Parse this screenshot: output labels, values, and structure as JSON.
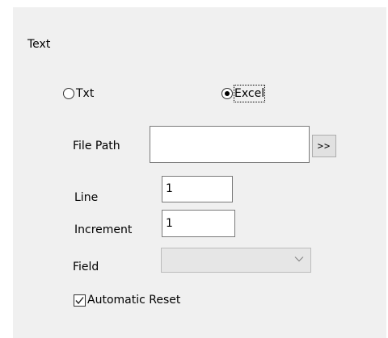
{
  "section": {
    "title": "Text"
  },
  "source_type": {
    "options": [
      {
        "label": "Txt",
        "selected": false
      },
      {
        "label": "Excel",
        "selected": true
      }
    ]
  },
  "file_path": {
    "label": "File Path",
    "value": "",
    "browse_label": ">>"
  },
  "line": {
    "label": "Line",
    "value": "1"
  },
  "increment": {
    "label": "Increment",
    "value": "1"
  },
  "field": {
    "label": "Field",
    "value": "",
    "enabled": false
  },
  "automatic_reset": {
    "label": "Automatic Reset",
    "checked": true
  },
  "icons": {
    "chevron": "chevron-down-icon",
    "check": "checkmark-icon"
  },
  "colors": {
    "panel_bg": "#f0f0f0",
    "button_bg": "#e1e1e1",
    "disabled_combo_bg": "#e6e6e6"
  }
}
